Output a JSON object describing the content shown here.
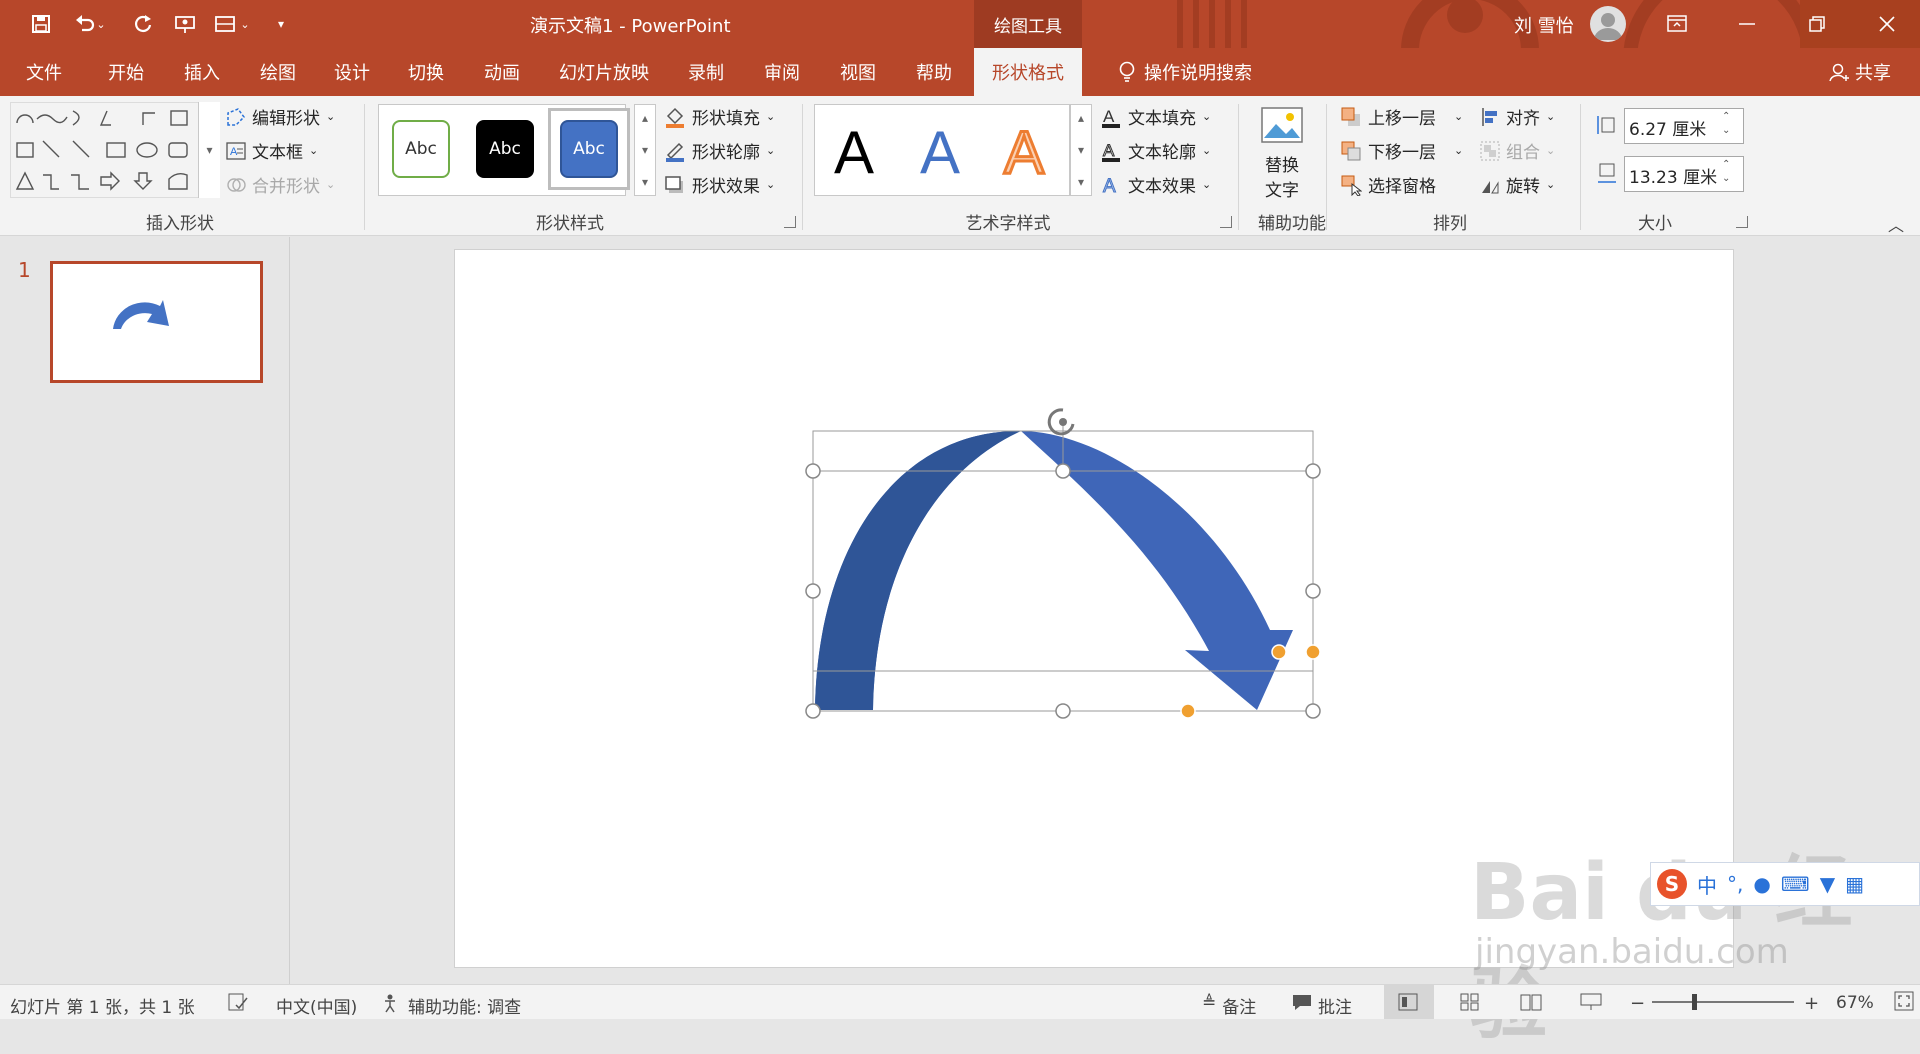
{
  "titlebar": {
    "doc_title": "演示文稿1  -  PowerPoint",
    "context_tools": "绘图工具",
    "user_name": "刘 雪怡",
    "qat": [
      "save-icon",
      "undo-icon",
      "redo-icon",
      "present-icon",
      "layout-icon",
      "customize-icon"
    ]
  },
  "tabs": [
    {
      "label": "文件"
    },
    {
      "label": "开始"
    },
    {
      "label": "插入"
    },
    {
      "label": "绘图"
    },
    {
      "label": "设计"
    },
    {
      "label": "切换"
    },
    {
      "label": "动画"
    },
    {
      "label": "幻灯片放映"
    },
    {
      "label": "录制"
    },
    {
      "label": "审阅"
    },
    {
      "label": "视图"
    },
    {
      "label": "帮助"
    },
    {
      "label": "形状格式"
    }
  ],
  "search": {
    "label": "操作说明搜索"
  },
  "share": {
    "label": "共享"
  },
  "ribbon": {
    "insert_shapes": {
      "group_label": "插入形状",
      "edit_shape": "编辑形状",
      "text_box": "文本框",
      "merge_shapes": "合并形状"
    },
    "shape_styles": {
      "group_label": "形状样式",
      "swatches": [
        "Abc",
        "Abc",
        "Abc"
      ],
      "fill": "形状填充",
      "outline": "形状轮廓",
      "effects": "形状效果"
    },
    "wordart": {
      "group_label": "艺术字样式",
      "samples": [
        "A",
        "A",
        "A"
      ],
      "text_fill": "文本填充",
      "text_outline": "文本轮廓",
      "text_effects": "文本效果"
    },
    "accessibility": {
      "group_label": "辅助功能",
      "alt_text_line1": "替换",
      "alt_text_line2": "文字"
    },
    "arrange": {
      "group_label": "排列",
      "bring_forward": "上移一层",
      "send_backward": "下移一层",
      "selection_pane": "选择窗格",
      "align": "对齐",
      "group": "组合",
      "rotate": "旋转"
    },
    "size": {
      "group_label": "大小",
      "height": "6.27 厘米",
      "width": "13.23 厘米"
    }
  },
  "slides_pane": {
    "slide_number": "1"
  },
  "statusbar": {
    "slide_info": "幻灯片 第 1 张，共 1 张",
    "language": "中文(中国)",
    "accessibility": "辅助功能: 调查",
    "notes": "备注",
    "comments": "批注",
    "zoom": "67%"
  },
  "watermark": {
    "brand": "Bai du 经验",
    "url": "jingyan.baidu.com"
  },
  "ime": {
    "mode": "中"
  },
  "colors": {
    "accent": "#b7472a",
    "shape_fill": "#4472c4",
    "shape_dark": "#2f5597",
    "handle_orange": "#f0a030"
  }
}
